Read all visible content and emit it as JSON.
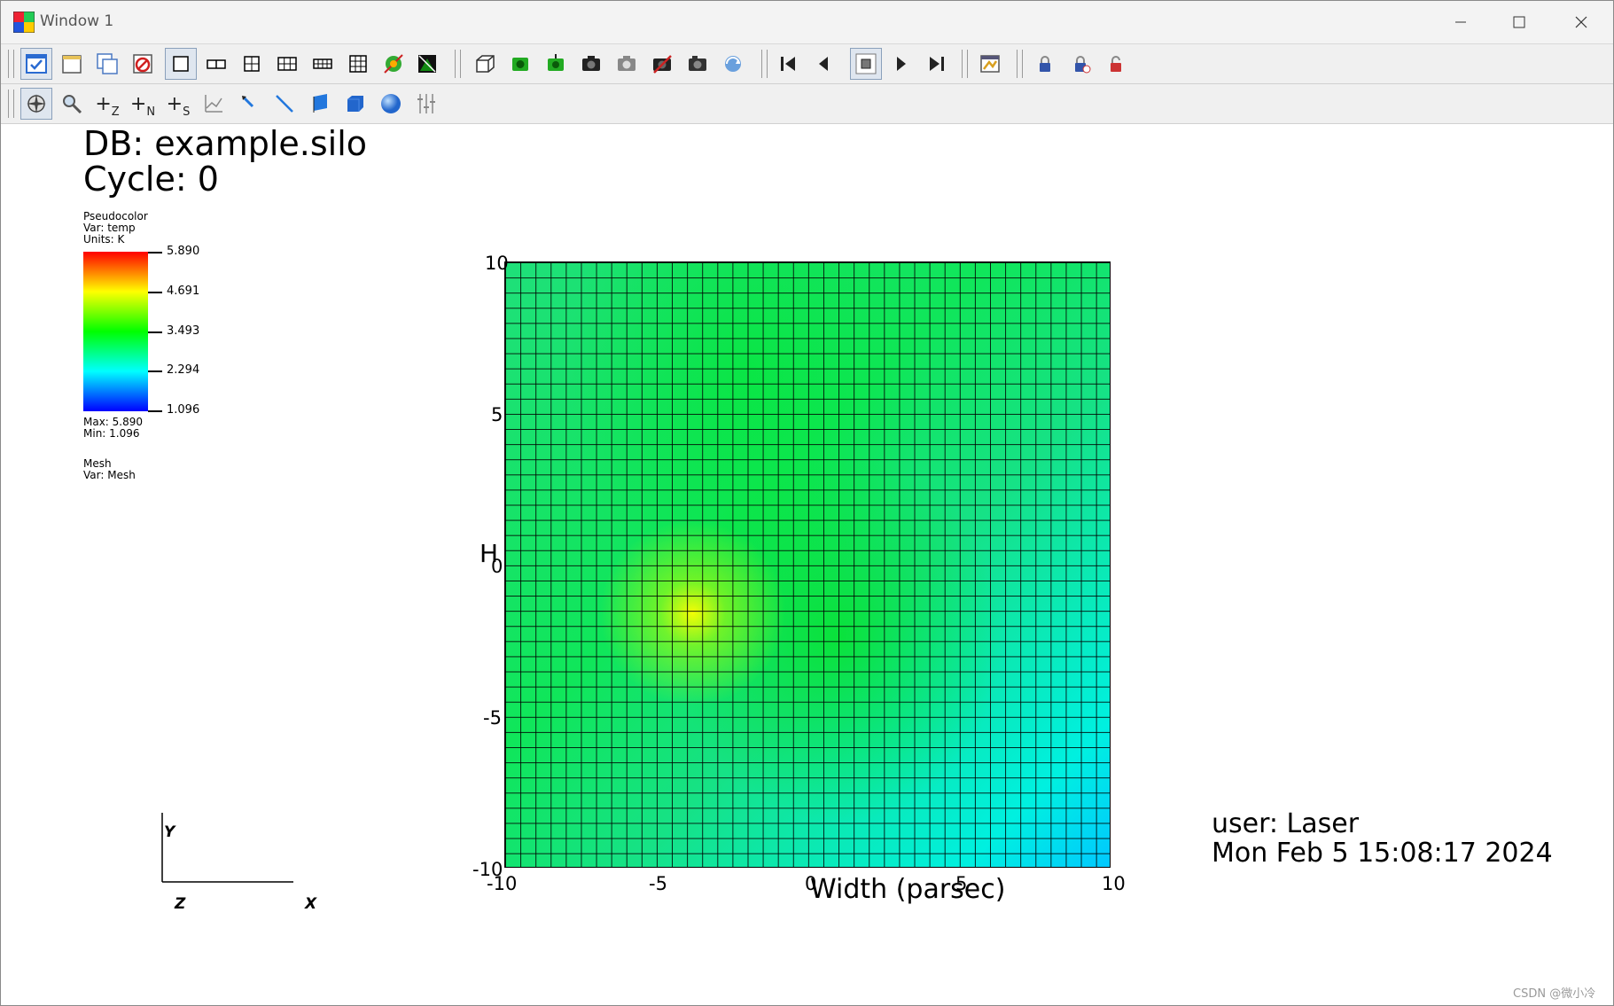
{
  "window": {
    "title": "Window 1"
  },
  "toolbar1": [
    {
      "name": "active-window-checkbox-icon",
      "color": "#2a6bd1"
    },
    {
      "name": "new-window-icon",
      "color": "#e8c35a"
    },
    {
      "name": "clone-window-icon",
      "color": "#4a78c2"
    },
    {
      "name": "delete-window-icon",
      "color": "#d02020"
    },
    {
      "name": "layout-1x1-icon",
      "color": "#000000"
    },
    {
      "name": "layout-1x2-icon",
      "color": "#000000"
    },
    {
      "name": "layout-2x2-icon",
      "color": "#000000"
    },
    {
      "name": "layout-2x3-icon",
      "color": "#000000"
    },
    {
      "name": "layout-2x4-icon",
      "color": "#000000"
    },
    {
      "name": "layout-3x3-icon",
      "color": "#000000"
    },
    {
      "name": "invert-background-icon",
      "color": "#33aa33"
    },
    {
      "name": "auto-update-icon",
      "color": "#118811"
    },
    {
      "name": "perspective-toggle-icon",
      "color": "#333333"
    },
    {
      "name": "reset-view-icon",
      "color": "#22aa22"
    },
    {
      "name": "recenter-view-icon",
      "color": "#22aa22"
    },
    {
      "name": "save-view-icon",
      "color": "#222222"
    },
    {
      "name": "choose-view-icon",
      "color": "#888888"
    },
    {
      "name": "clear-view-icon",
      "color": "#cc2222"
    },
    {
      "name": "camera-icon",
      "color": "#333333"
    },
    {
      "name": "spin-icon",
      "color": "#6aa0dd"
    },
    {
      "name": "first-frame-icon",
      "color": "#222222"
    },
    {
      "name": "previous-frame-icon",
      "color": "#222222"
    },
    {
      "name": "stop-icon",
      "color": "#222222"
    },
    {
      "name": "play-icon",
      "color": "#222222"
    },
    {
      "name": "last-frame-icon",
      "color": "#222222"
    },
    {
      "name": "animation-settings-icon",
      "color": "#d9a020"
    },
    {
      "name": "lock-view-icon",
      "color": "#3355aa"
    },
    {
      "name": "lock-time-icon",
      "color": "#3355aa"
    },
    {
      "name": "unlock-icon",
      "color": "#cc3333"
    }
  ],
  "toolbar2": [
    {
      "name": "navigate-mode-icon",
      "label": "",
      "color": "#444444"
    },
    {
      "name": "zoom-mode-icon",
      "label": "",
      "color": "#555555"
    },
    {
      "name": "zone-pick-icon",
      "label": "+Z",
      "color": "#222222"
    },
    {
      "name": "node-pick-icon",
      "label": "+N",
      "color": "#222222"
    },
    {
      "name": "spreadsheet-pick-icon",
      "label": "+S",
      "color": "#222222"
    },
    {
      "name": "curve-pick-icon",
      "label": "",
      "color": "#888888"
    },
    {
      "name": "line-lineout-icon",
      "label": "",
      "color": "#2277dd"
    },
    {
      "name": "line-tool-icon",
      "label": "",
      "color": "#2277dd"
    },
    {
      "name": "plane-tool-icon",
      "label": "",
      "color": "#2277dd"
    },
    {
      "name": "box-tool-icon",
      "label": "",
      "color": "#2266cc"
    },
    {
      "name": "sphere-tool-icon",
      "label": "",
      "color": "#2266cc"
    },
    {
      "name": "axis-restriction-icon",
      "label": "",
      "color": "#888888"
    }
  ],
  "annotations": {
    "db": "DB: example.silo",
    "cycle": "Cycle: 0",
    "user": "user: Laser",
    "date": "Mon Feb  5 15:08:17 2024",
    "watermark": "CSDN @微小冷"
  },
  "legend": {
    "plot_type": "Pseudocolor",
    "var": "Var: temp",
    "units": "Units: K",
    "ticks": [
      "5.890",
      "4.691",
      "3.493",
      "2.294",
      "1.096"
    ],
    "max": "Max:  5.890",
    "min": "Min:  1.096",
    "mesh_title": "Mesh",
    "mesh_var": "Var: Mesh"
  },
  "plot": {
    "x_ticks": [
      "-10",
      "-5",
      "0",
      "5",
      "10"
    ],
    "y_ticks": [
      "10",
      "5",
      "0",
      "-5",
      "-10"
    ],
    "x_title": "Width (parsec)",
    "y_title": "H",
    "mesh_cells": 40
  },
  "triad": {
    "x": "X",
    "y": "Y",
    "z": "Z"
  }
}
